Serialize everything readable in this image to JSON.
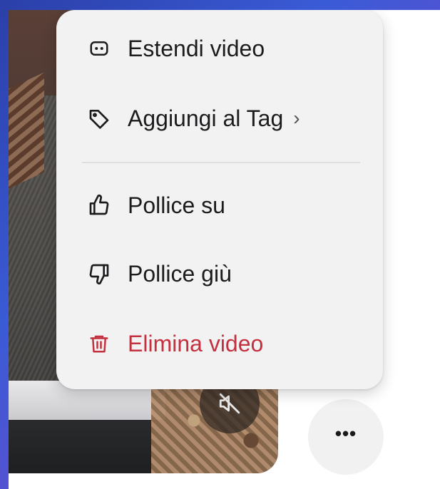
{
  "menu": {
    "items": [
      {
        "id": "extend",
        "label": "Estendi video",
        "icon": "extend-video-icon"
      },
      {
        "id": "tag",
        "label": "Aggiungi al Tag",
        "icon": "tag-icon",
        "submenu_indicator": "›"
      },
      {
        "id": "thumbs-up",
        "label": "Pollice su",
        "icon": "thumbs-up-icon"
      },
      {
        "id": "thumbs-down",
        "label": "Pollice giù",
        "icon": "thumbs-down-icon"
      },
      {
        "id": "delete",
        "label": "Elimina video",
        "icon": "trash-icon",
        "color": "#c5303f"
      }
    ]
  },
  "video": {
    "mute_icon": "muted-speaker-icon"
  },
  "more_button": {
    "label": "•••",
    "icon": "more-horizontal-icon"
  }
}
